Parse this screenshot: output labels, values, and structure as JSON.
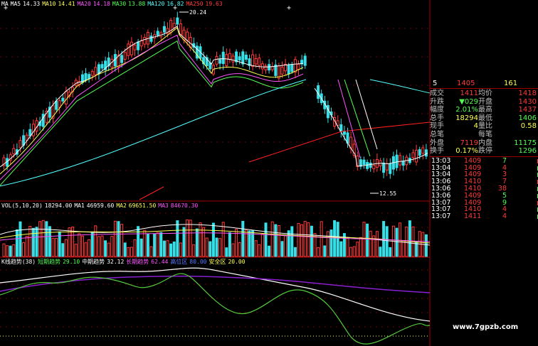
{
  "colors": {
    "up": "#ff3b3b",
    "down": "#36e0e8",
    "cyan": "#54ffff",
    "yellow": "#ffff54",
    "green": "#54ff54",
    "magenta": "#ff54ff",
    "white": "#ffffff",
    "red": "#ff2020",
    "gray": "#c0c0c0",
    "blue": "#5a7cff"
  },
  "ma_header": [
    {
      "text": "MA",
      "color": "#ffffff"
    },
    {
      "text": "MA5",
      "color": "#ffffff"
    },
    {
      "text": "14.33",
      "color": "#ffffff"
    },
    {
      "text": "MA10",
      "color": "#ffff54"
    },
    {
      "text": "14.41",
      "color": "#ffff54"
    },
    {
      "text": "MA20",
      "color": "#ff54ff"
    },
    {
      "text": "14.18",
      "color": "#ff54ff"
    },
    {
      "text": "MA30",
      "color": "#54ff54"
    },
    {
      "text": "13.88",
      "color": "#54ff54"
    },
    {
      "text": "MA120",
      "color": "#54ffff"
    },
    {
      "text": "16.82",
      "color": "#54ffff"
    },
    {
      "text": "MA250",
      "color": "#ff3b3b"
    },
    {
      "text": "19.63",
      "color": "#ff3b3b"
    }
  ],
  "price_labels": {
    "high": "20.24",
    "low": "12.55"
  },
  "vol_header": [
    {
      "text": "VOL(5,10,20)",
      "color": "#ffffff"
    },
    {
      "text": "18294.00",
      "color": "#ffffff"
    },
    {
      "text": "MA1",
      "color": "#ffffff"
    },
    {
      "text": "46959.60",
      "color": "#ffffff"
    },
    {
      "text": "MA2",
      "color": "#ffff54"
    },
    {
      "text": "69651.50",
      "color": "#ffff54"
    },
    {
      "text": "MA3",
      "color": "#ff54ff"
    },
    {
      "text": "84670.30",
      "color": "#ff54ff"
    }
  ],
  "indicator_header": [
    {
      "text": "K线趋势(38)",
      "color": "#ffffff"
    },
    {
      "text": "短期趋势",
      "color": "#54ff54"
    },
    {
      "text": "29.10",
      "color": "#54ff54"
    },
    {
      "text": "中期趋势",
      "color": "#ffffff"
    },
    {
      "text": "32.12",
      "color": "#ffffff"
    },
    {
      "text": "长期趋势",
      "color": "#ff54ff"
    },
    {
      "text": "62.44",
      "color": "#ff54ff"
    },
    {
      "text": "高位区",
      "color": "#5a7cff"
    },
    {
      "text": "80.00",
      "color": "#5a7cff"
    },
    {
      "text": "安全区",
      "color": "#ffff54"
    },
    {
      "text": "20.00",
      "color": "#ffff54"
    }
  ],
  "quote_top_partial": {
    "a": "5",
    "b": "1405",
    "c": "161"
  },
  "quote_rows": [
    {
      "l1": "成交",
      "v1": "1411",
      "v1c": "#ff3b3b",
      "l2": "均价",
      "v2": "1418",
      "v2c": "#ff3b3b"
    },
    {
      "l1": "升跌",
      "v1": "▼029",
      "v1c": "#54ff54",
      "l2": "开盘",
      "v2": "1430",
      "v2c": "#ff3b3b"
    },
    {
      "l1": "幅度",
      "v1": "2.01%",
      "v1c": "#54ff54",
      "l2": "最高",
      "v2": "1437",
      "v2c": "#ff3b3b"
    },
    {
      "l1": "总手",
      "v1": "18294",
      "v1c": "#ffff54",
      "l2": "最低",
      "v2": "1406",
      "v2c": "#54ff54"
    },
    {
      "l1": "现手",
      "v1": "4",
      "v1c": "#ffff54",
      "l2": "量比",
      "v2": "0.58",
      "v2c": "#ffff54"
    },
    {
      "l1": "总笔",
      "v1": "",
      "v1c": "#ffffff",
      "l2": "每笔",
      "v2": "",
      "v2c": "#ffffff"
    },
    {
      "l1": "外盘",
      "v1": "7119",
      "v1c": "#ff3b3b",
      "l2": "内盘",
      "v2": "11175",
      "v2c": "#54ff54"
    },
    {
      "l1": "换手",
      "v1": "0.17%",
      "v1c": "#ffff54",
      "l2": "跌停",
      "v2": "1296",
      "v2c": "#54ff54"
    }
  ],
  "trades": [
    {
      "time": "13:03",
      "price": "1409",
      "vol": "7",
      "vc": "#54ff54"
    },
    {
      "time": "13:04",
      "price": "1409",
      "vol": "4",
      "vc": "#ff3b3b"
    },
    {
      "time": "13:04",
      "price": "1409",
      "vol": "3",
      "vc": "#ff3b3b"
    },
    {
      "time": "13:06",
      "price": "1410",
      "vol": "7",
      "vc": "#ff3b3b"
    },
    {
      "time": "13:06",
      "price": "1410",
      "vol": "38",
      "vc": "#ff3b3b"
    },
    {
      "time": "13:06",
      "price": "1409",
      "vol": "5",
      "vc": "#54ff54"
    },
    {
      "time": "13:07",
      "price": "1409",
      "vol": "9",
      "vc": "#54ff54"
    },
    {
      "time": "13:07",
      "price": "1410",
      "vol": "4",
      "vc": "#ff3b3b"
    },
    {
      "time": "13:07",
      "price": "1411",
      "vol": "4",
      "vc": "#ff3b3b"
    }
  ],
  "watermark": "www.7gpzb.com"
}
